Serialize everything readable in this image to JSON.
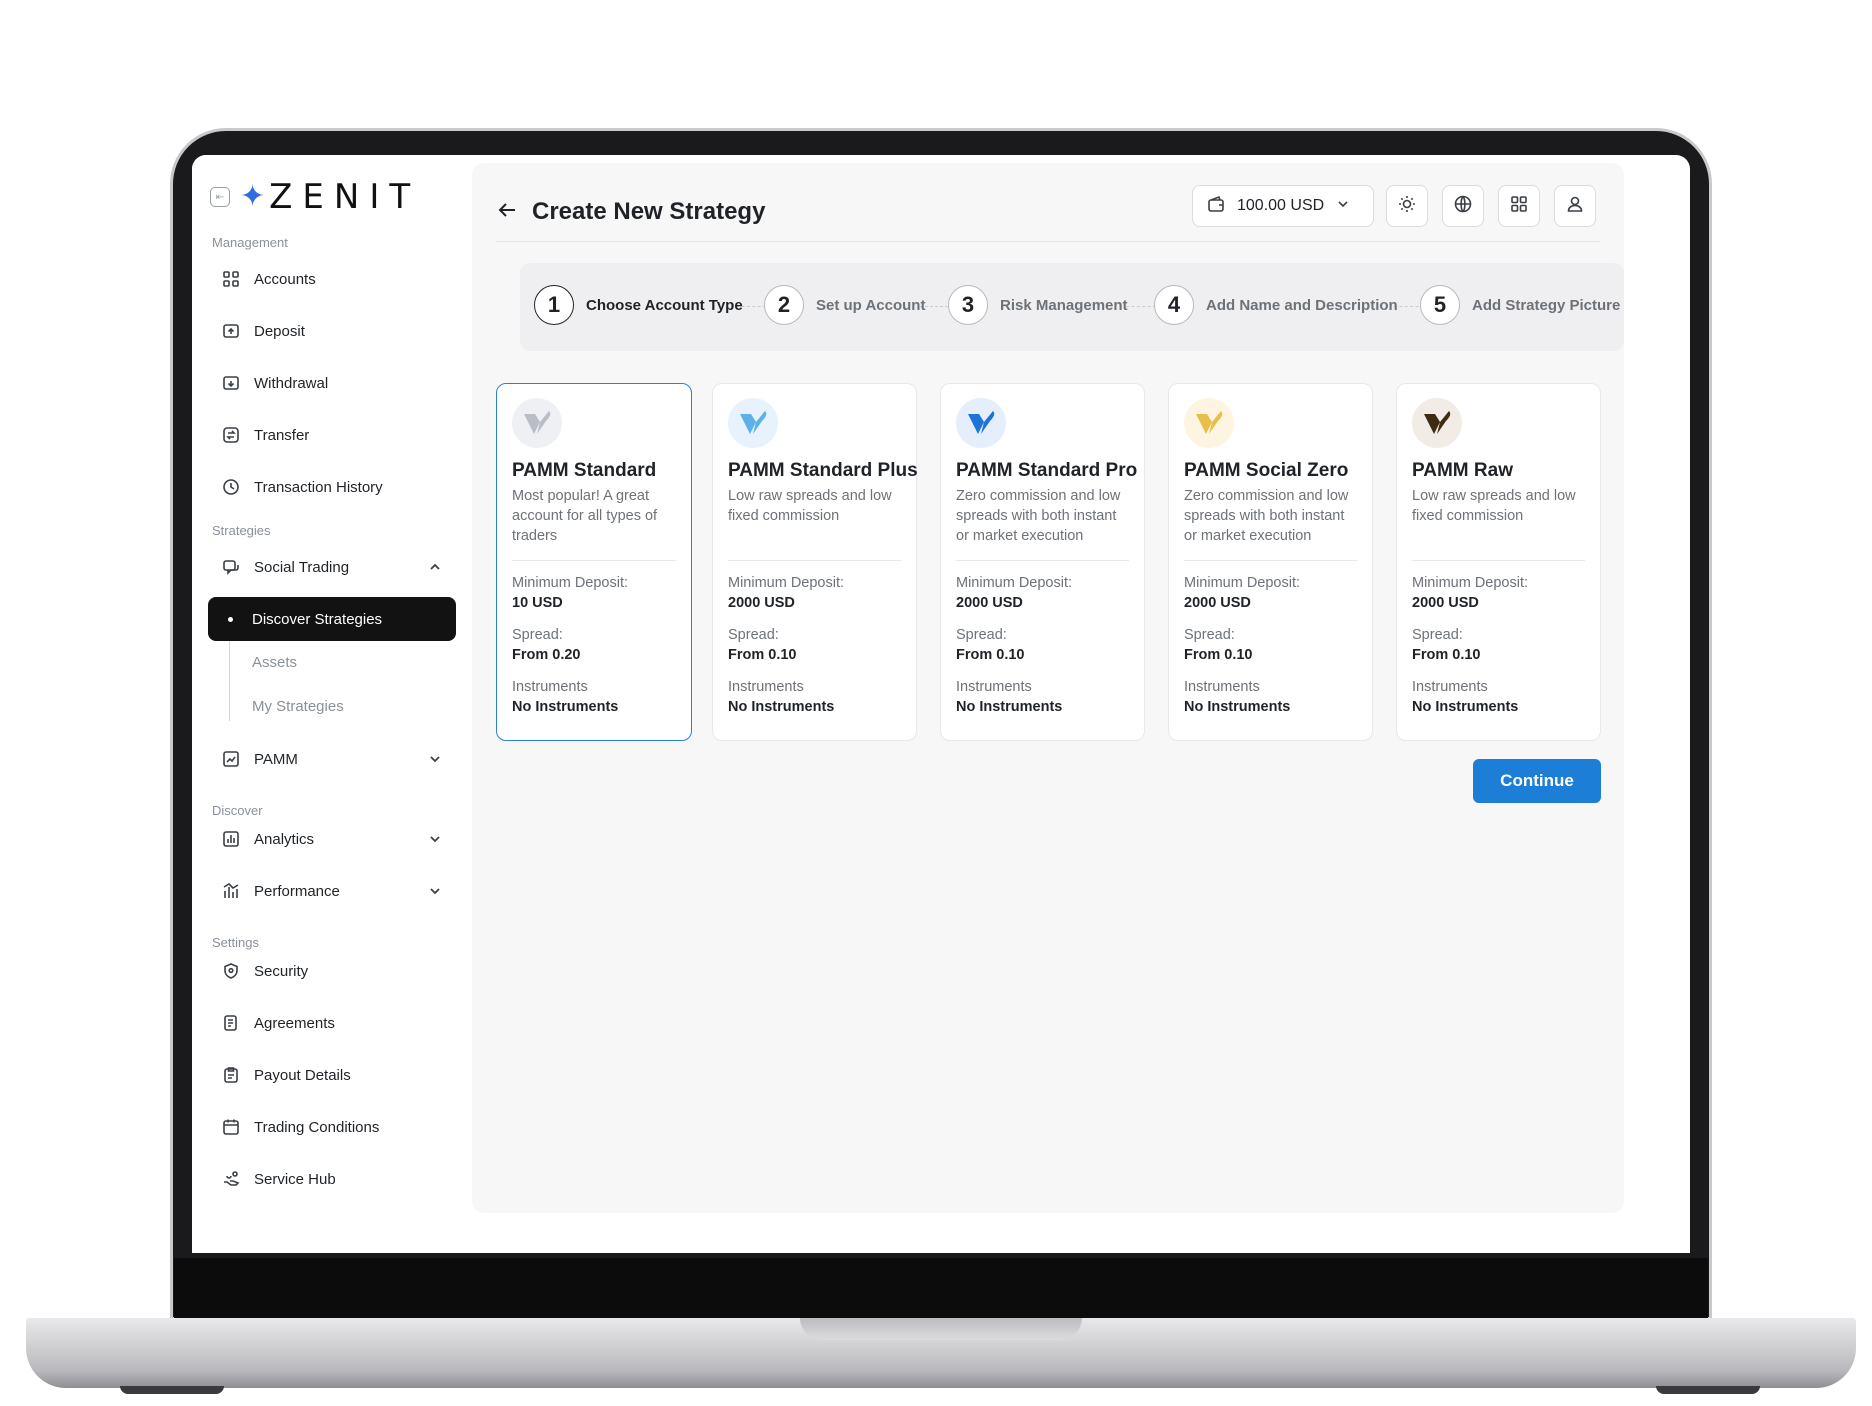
{
  "app": {
    "logo_text": "ZENIT"
  },
  "sidebar": {
    "sections": {
      "management": "Management",
      "strategies": "Strategies",
      "discover": "Discover",
      "settings": "Settings"
    },
    "items": {
      "accounts": "Accounts",
      "deposit": "Deposit",
      "withdrawal": "Withdrawal",
      "transfer": "Transfer",
      "transaction_history": "Transaction History",
      "social_trading": "Social Trading",
      "discover_strategies": "Discover Strategies",
      "assets": "Assets",
      "my_strategies": "My Strategies",
      "pamm": "PAMM",
      "analytics": "Analytics",
      "performance": "Performance",
      "security": "Security",
      "agreements": "Agreements",
      "payout_details": "Payout Details",
      "trading_conditions": "Trading Conditions",
      "service_hub": "Service Hub"
    }
  },
  "header": {
    "title": "Create New Strategy",
    "balance": "100.00 USD"
  },
  "steps": [
    {
      "num": "1",
      "label": "Choose Account Type",
      "active": true
    },
    {
      "num": "2",
      "label": "Set up Account"
    },
    {
      "num": "3",
      "label": "Risk Management"
    },
    {
      "num": "4",
      "label": "Add Name and Description"
    },
    {
      "num": "5",
      "label": "Add Strategy Picture"
    }
  ],
  "fields": {
    "min_deposit": "Minimum Deposit:",
    "spread": "Spread:",
    "instruments": "Instruments"
  },
  "cards": [
    {
      "title": "PAMM Standard",
      "desc": "Most popular! A great account for all types of traders",
      "min_deposit": "10 USD",
      "spread": "From 0.20",
      "instruments": "No Instruments",
      "logo_bg": "#eef0f3",
      "logo_color": "#b9bec6",
      "selected": true
    },
    {
      "title": "PAMM Standard Plus",
      "desc": "Low raw spreads and low fixed commission",
      "min_deposit": "2000 USD",
      "spread": "From 0.10",
      "instruments": "No Instruments",
      "logo_bg": "#e7f2fc",
      "logo_color": "#5db0ea"
    },
    {
      "title": "PAMM Standard Pro",
      "desc": "Zero commission and low spreads with both instant or market execution",
      "min_deposit": "2000 USD",
      "spread": "From 0.10",
      "instruments": "No Instruments",
      "logo_bg": "#e5effb",
      "logo_color": "#1c73d8"
    },
    {
      "title": "PAMM Social Zero",
      "desc": "Zero commission and low spreads with both instant or market execution",
      "min_deposit": "2000 USD",
      "spread": "From 0.10",
      "instruments": "No Instruments",
      "logo_bg": "#fdf5e2",
      "logo_color": "#e8bf4b"
    },
    {
      "title": "PAMM Raw",
      "desc": "Low raw spreads and low fixed commission",
      "min_deposit": "2000 USD",
      "spread": "From 0.10",
      "instruments": "No Instruments",
      "logo_bg": "#f1ede6",
      "logo_color": "#3d2c12"
    }
  ],
  "actions": {
    "continue": "Continue"
  },
  "colors": {
    "accent": "#1c7ed6",
    "active_nav": "#121212"
  }
}
